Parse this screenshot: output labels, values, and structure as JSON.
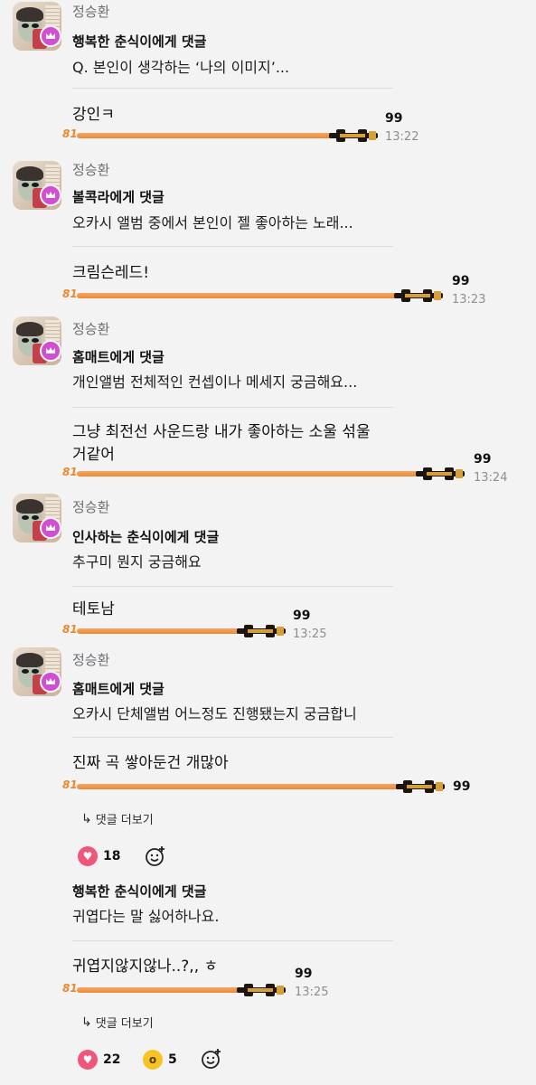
{
  "threads": [
    {
      "username": "정승환",
      "reply_title": "행복한 춘식이에게 댓글",
      "question": "Q. 본인이 생각하는 ‘나의 이미지’...",
      "answer": "강인ㅋ",
      "rank": "81",
      "score": "99",
      "time": "13:22"
    },
    {
      "username": "정승환",
      "reply_title": "볼콕라에게 댓글",
      "question": "오카시 앨범 중에서 본인이 젤 좋아하는 노래...",
      "answer": "크림슨레드!",
      "rank": "81",
      "score": "99",
      "time": "13:23"
    },
    {
      "username": "정승환",
      "reply_title": "홈매트에게 댓글",
      "question": "개인앨범 전체적인 컨셉이나 메세지 궁금해요...",
      "answer_line1": "그냥 최전선 사운드랑 내가 좋아하는 소울 섞울",
      "answer_line2": "거같어",
      "rank": "81",
      "score": "99",
      "time": "13:24"
    },
    {
      "username": "정승환",
      "reply_title": "인사하는 춘식이에게 댓글",
      "question": "추구미 뭔지 궁금해요",
      "answer": "테토남",
      "rank": "81",
      "score": "99",
      "time": "13:25"
    },
    {
      "username": "정승환",
      "reply_title": "홈매트에게 댓글",
      "question": "오카시 단체앨범 어느정도 진행됐는지 궁금합니",
      "answer": "진짜 곡 쌓아둔건 개많아",
      "rank": "81",
      "score": "99",
      "more_label": "댓글 더보기",
      "hearts": "18"
    },
    {
      "reply_title": "행복한 춘식이에게 댓글",
      "question": "귀엽다는 말 싫어하나요.",
      "answer": "귀엽지않지않나..?,, ㅎ",
      "rank": "81",
      "score": "99",
      "time": "13:25",
      "more_label": "댓글 더보기",
      "hearts": "22",
      "wows": "5"
    }
  ],
  "icons": {
    "badge": "crown-icon",
    "car": "race-car-icon",
    "more": "reply-arrow-icon",
    "heart": "heart-icon",
    "wow": "surprised-face-icon",
    "add": "add-reaction-icon"
  },
  "colors": {
    "bar": "#ea8a36",
    "badge": "#cf4fd0",
    "heart": "#f0557a"
  }
}
